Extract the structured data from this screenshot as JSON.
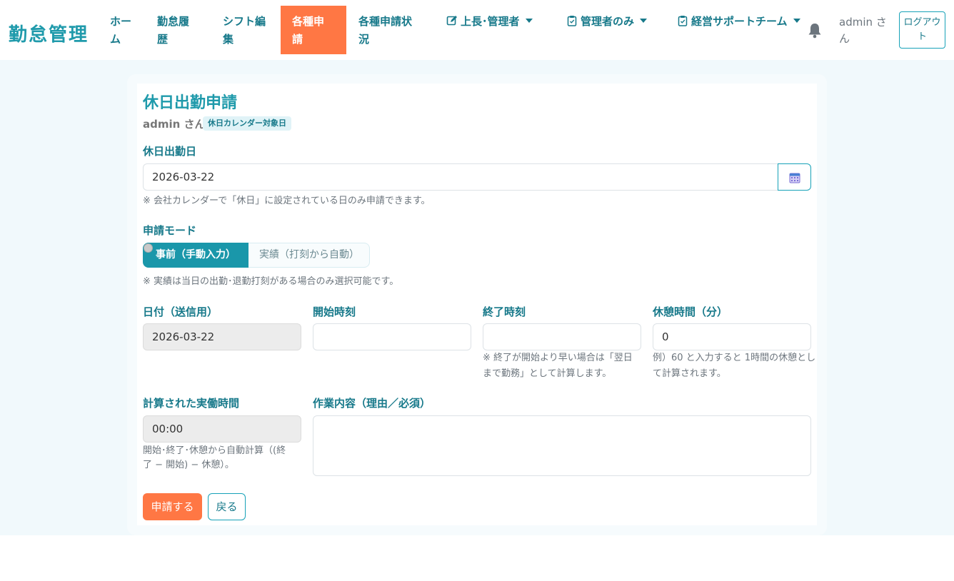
{
  "nav": {
    "brand": "勤怠管理",
    "items": [
      {
        "line1": "ホー",
        "line2": "ム"
      },
      {
        "line1": "勤怠履",
        "line2": "歴"
      },
      {
        "line1": "シフト編",
        "line2": "集"
      },
      {
        "line1": "各種申",
        "line2": "請"
      },
      {
        "line1": "各種申請状",
        "line2": "況"
      }
    ],
    "dropdowns": [
      {
        "label": "上長･管理者",
        "icon": "edit-icon"
      },
      {
        "label": "管理者のみ",
        "icon": "clipboard-icon"
      },
      {
        "label": "経営サポートチーム",
        "icon": "clipboard-check-icon"
      }
    ],
    "user": "admin さん",
    "logout_line1": "ログアウ",
    "logout_line2": "ト"
  },
  "form": {
    "title": "休日出勤申請",
    "user": "admin さん",
    "badge": "休日カレンダー対象日",
    "date_label": "休日出勤日",
    "date_value": "2026-03-22",
    "date_help": "※ 会社カレンダーで「休日」に設定されている日のみ申請できます。",
    "mode_label": "申請モード",
    "mode_on": "事前（手動入力）",
    "mode_off": "実績（打刻から自動）",
    "mode_help": "※ 実績は当日の出勤･退勤打刻がある場合のみ選択可能です。",
    "send_date_label": "日付（送信用）",
    "send_date_value": "2026-03-22",
    "start_label": "開始時刻",
    "start_value": "",
    "end_label": "終了時刻",
    "end_value": "",
    "end_help_1": "※ 終了が開始より早い場合は「翌日",
    "end_help_2": "まで勤務」として計算します。",
    "break_label": "休憩時間（分）",
    "break_value": "0",
    "break_help_1": "例）60 と入力すると 1時間の休憩とし",
    "break_help_2": "て計算されます。",
    "worked_label": "計算された実働時間",
    "worked_value": "00:00",
    "worked_help_1": "開始･終了･休憩から自動計算（(終",
    "worked_help_2": "了 − 開始) − 休憩）。",
    "task_label": "作業内容（理由／必須）",
    "task_value": "",
    "submit": "申請する",
    "back": "戻る"
  },
  "colors": {
    "accent": "#1f9aab",
    "orange": "#ff7744",
    "text_teal": "#17798a"
  }
}
